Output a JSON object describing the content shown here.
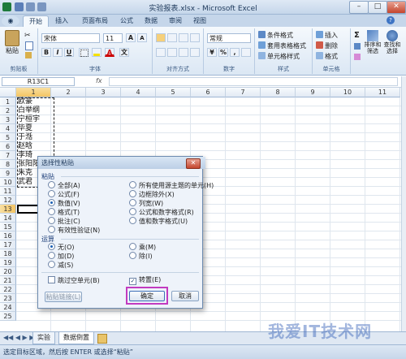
{
  "window": {
    "title": "实验报表.xlsx - Microsoft Excel",
    "minimize": "–",
    "maximize": "□",
    "close": "✕"
  },
  "tabs": [
    "开始",
    "插入",
    "页面布局",
    "公式",
    "数据",
    "审阅",
    "视图"
  ],
  "ribbon": {
    "paste_label": "粘贴",
    "clipboard_label": "剪贴板",
    "font_name": "宋体",
    "font_size": "11",
    "bold": "B",
    "italic": "I",
    "underline": "U",
    "grow_font": "A",
    "shrink_font": "A",
    "font_color_glyph": "A",
    "font_group_label": "字体",
    "align_group_label": "对齐方式",
    "number_format": "常规",
    "number_group_label": "数字",
    "percent": "%",
    "comma": ",",
    "conditional_format": "条件格式",
    "table_format": "套用表格格式",
    "cell_style": "单元格样式",
    "styles_group_label": "样式",
    "insert": "插入",
    "delete": "删除",
    "format": "格式",
    "cells_group_label": "单元格",
    "sort_filter": "排序和\n筛选",
    "find_select": "查找和\n选择",
    "sigma": "Σ",
    "currency": "¥"
  },
  "formula_bar": {
    "name_box": "R13C1",
    "fx": "fx",
    "formula": ""
  },
  "grid": {
    "columns": [
      "1",
      "2",
      "3",
      "4",
      "5",
      "6",
      "7",
      "8",
      "9",
      "10",
      "11"
    ],
    "rows": [
      "1",
      "2",
      "3",
      "4",
      "5",
      "6",
      "7",
      "8",
      "9",
      "10",
      "11",
      "12",
      "13",
      "14",
      "15",
      "16",
      "17",
      "18",
      "19",
      "20",
      "21",
      "22",
      "23",
      "24",
      "25"
    ],
    "cells": [
      "欧豪",
      "白举纲",
      "宁桓宇",
      "毕夏",
      "于湉",
      "赵晗",
      "李琦",
      "张阳阳",
      "朱克",
      "武君"
    ]
  },
  "sheets": [
    "实验",
    "数据倒置"
  ],
  "status": "选定目标区域，然后按 ENTER 或选择“粘贴”",
  "dialog": {
    "title": "选择性粘贴",
    "close": "✕",
    "paste_section": "粘贴",
    "paste_left": [
      "全部(A)",
      "公式(F)",
      "数值(V)",
      "格式(T)",
      "批注(C)",
      "有效性验证(N)"
    ],
    "paste_right": [
      "所有使用源主题的单元(H)",
      "边框除外(X)",
      "列宽(W)",
      "公式和数字格式(R)",
      "值和数字格式(U)"
    ],
    "paste_selected": "数值(V)",
    "operation_section": "运算",
    "op_left": [
      "无(O)",
      "加(D)",
      "减(S)"
    ],
    "op_right": [
      "乘(M)",
      "除(I)"
    ],
    "op_selected": "无(O)",
    "skip_blanks": "跳过空单元(B)",
    "transpose": "转置(E)",
    "transpose_checked": "✓",
    "paste_link": "粘贴链接(L)",
    "ok": "确定",
    "cancel": "取消"
  },
  "watermark": "我爱IT技术网",
  "colors": {
    "accent": "#1a5fb4",
    "highlight": "#c23bc0",
    "ribbon": "#dbe7f4"
  }
}
